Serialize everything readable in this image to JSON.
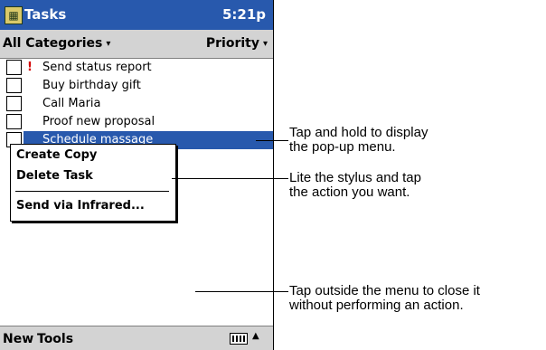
{
  "titlebar": {
    "app_title": "Tasks",
    "time": "5:21p",
    "icon": "tasks-app-icon"
  },
  "filterbar": {
    "category_label": "All Categories",
    "sort_label": "Priority",
    "caret": "▾"
  },
  "tasks": [
    {
      "label": "Send status report",
      "priority_mark": "!",
      "selected": false
    },
    {
      "label": "Buy birthday gift",
      "priority_mark": "",
      "selected": false
    },
    {
      "label": "Call Maria",
      "priority_mark": "",
      "selected": false
    },
    {
      "label": "Proof new proposal",
      "priority_mark": "",
      "selected": false
    },
    {
      "label": "Schedule massage",
      "priority_mark": "",
      "selected": true
    }
  ],
  "popup_menu": {
    "items": [
      "Create Copy",
      "Delete Task",
      "Send via Infrared..."
    ]
  },
  "commandbar": {
    "new_label": "New",
    "tools_label": "Tools",
    "sip_arrow": "▲"
  },
  "callouts": [
    {
      "line1": "Tap and hold to display",
      "line2": "the pop-up menu."
    },
    {
      "line1": "Lite the stylus and tap",
      "line2": "the action you want."
    },
    {
      "line1": "Tap outside the menu to close it",
      "line2": "without performing an action."
    }
  ],
  "colors": {
    "titlebar": "#2859ad",
    "selection": "#2859ad",
    "priority": "#d40000",
    "bars": "#d3d3d3"
  }
}
